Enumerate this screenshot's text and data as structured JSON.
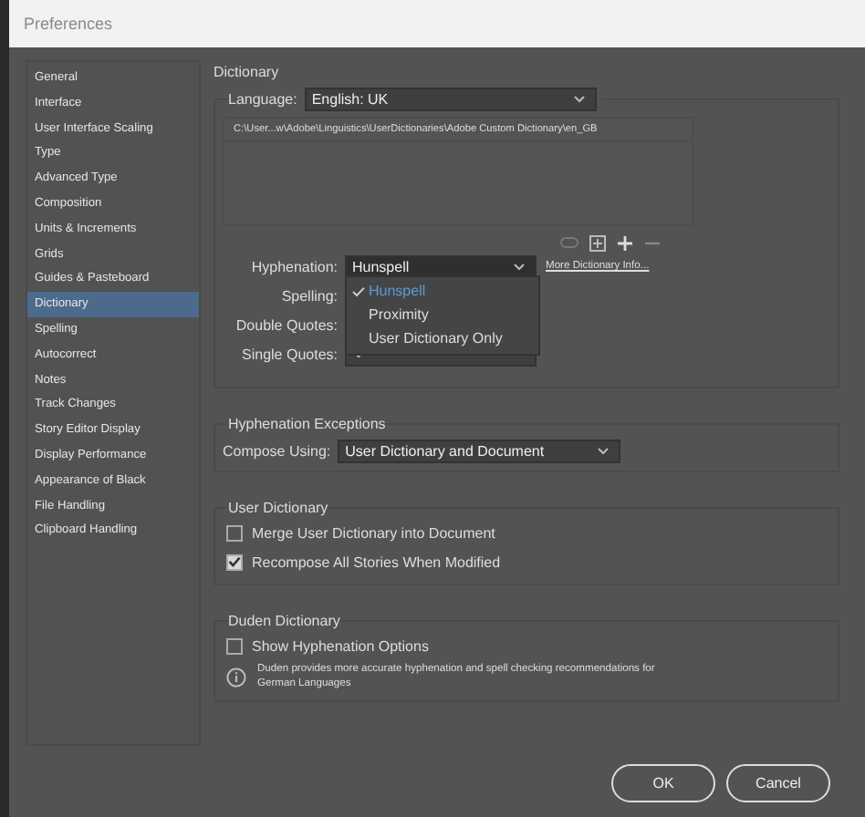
{
  "window": {
    "title": "Preferences"
  },
  "sidebar": {
    "items": [
      {
        "label": "General",
        "selected": false
      },
      {
        "label": "Interface",
        "selected": false
      },
      {
        "label": "User Interface Scaling",
        "selected": false
      },
      {
        "label": "Type",
        "selected": false
      },
      {
        "label": "Advanced Type",
        "selected": false
      },
      {
        "label": "Composition",
        "selected": false
      },
      {
        "label": "Units & Increments",
        "selected": false
      },
      {
        "label": "Grids",
        "selected": false
      },
      {
        "label": "Guides & Pasteboard",
        "selected": false
      },
      {
        "label": "Dictionary",
        "selected": true
      },
      {
        "label": "Spelling",
        "selected": false
      },
      {
        "label": "Autocorrect",
        "selected": false
      },
      {
        "label": "Notes",
        "selected": false
      },
      {
        "label": "Track Changes",
        "selected": false
      },
      {
        "label": "Story Editor Display",
        "selected": false
      },
      {
        "label": "Display Performance",
        "selected": false
      },
      {
        "label": "Appearance of Black",
        "selected": false
      },
      {
        "label": "File Handling",
        "selected": false
      },
      {
        "label": "Clipboard Handling",
        "selected": false
      }
    ]
  },
  "panel_title": "Dictionary",
  "language": {
    "label": "Language:",
    "value": "English: UK"
  },
  "dictionary_list": [
    "C:\\User...w\\Adobe\\Linguistics\\UserDictionaries\\Adobe Custom Dictionary\\en_GB"
  ],
  "hyphenation": {
    "label": "Hyphenation:",
    "value": "Hunspell",
    "expanded": true,
    "options": [
      {
        "label": "Hunspell",
        "selected": true
      },
      {
        "label": "Proximity",
        "selected": false
      },
      {
        "label": "User Dictionary Only",
        "selected": false
      }
    ]
  },
  "more_info_link": "More Dictionary Info...",
  "fields": [
    {
      "label": "Spelling:",
      "kind": "covered"
    },
    {
      "label": "Double Quotes:",
      "kind": "covered"
    },
    {
      "label": "Single Quotes:",
      "kind": "dropdown"
    }
  ],
  "hyphenation_exceptions": {
    "title": "Hyphenation Exceptions",
    "label": "Compose Using:",
    "value": "User Dictionary and Document"
  },
  "user_dictionary": {
    "title": "User Dictionary",
    "options": [
      {
        "label": "Merge User Dictionary into Document",
        "checked": false
      },
      {
        "label": "Recompose All Stories When Modified",
        "checked": true
      }
    ]
  },
  "duden_dictionary": {
    "title": "Duden Dictionary",
    "options": [
      {
        "label": "Show Hyphenation Options",
        "checked": false
      }
    ],
    "info": "Duden provides more accurate hyphenation and spell checking recommendations for German Languages"
  },
  "buttons": [
    {
      "label": "OK"
    },
    {
      "label": "Cancel"
    }
  ]
}
